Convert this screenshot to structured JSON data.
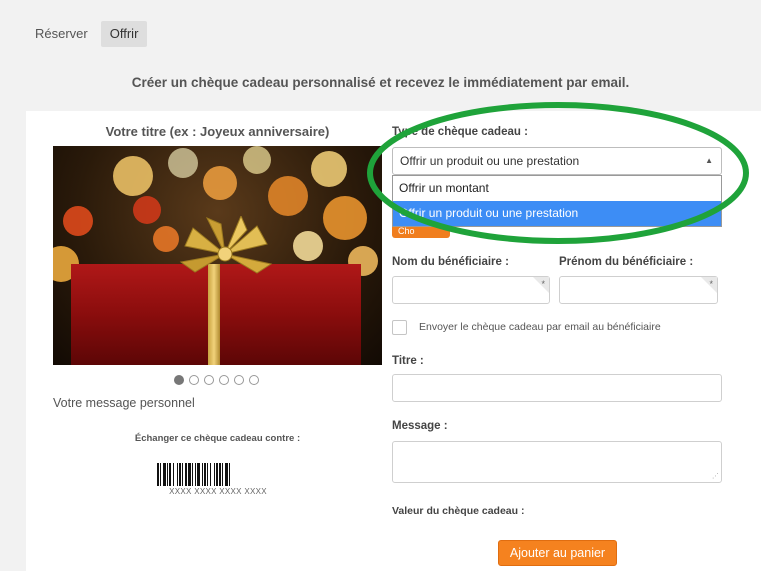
{
  "tabs": [
    {
      "label": "Réserver",
      "active": false
    },
    {
      "label": "Offrir",
      "active": true
    }
  ],
  "intro_text": "Créer un chèque cadeau personnalisé et recevez le immédiatement par email.",
  "left": {
    "title": "Votre titre (ex : Joyeux anniversaire)",
    "carousel": {
      "count": 6,
      "active_index": 0
    },
    "personal_message": "Votre message personnel",
    "exchange_text": "Échanger ce chèque cadeau contre :",
    "barcode_text": "XXXX XXXX XXXX XXXX"
  },
  "form": {
    "type_label": "Type de chèque cadeau :",
    "type_selected": "Offrir un produit ou une prestation",
    "type_options": [
      {
        "label": "Offrir un montant",
        "selected": false
      },
      {
        "label": "Offrir un produit ou une prestation",
        "selected": true
      }
    ],
    "hidden_button_label": "Cho",
    "beneficiary_last_name_label": "Nom du bénéficiaire :",
    "beneficiary_first_name_label": "Prénom du bénéficiaire :",
    "required_mark": "*",
    "send_email_label": "Envoyer le chèque cadeau par email au bénéficiaire",
    "send_email_checked": false,
    "title_label": "Titre :",
    "message_label": "Message :",
    "value_label": "Valeur du chèque cadeau :",
    "add_to_cart_label": "Ajouter au panier"
  },
  "colors": {
    "accent_orange": "#f5821f",
    "selected_blue": "#3d8df5",
    "annotation_green": "#1fa33a"
  }
}
